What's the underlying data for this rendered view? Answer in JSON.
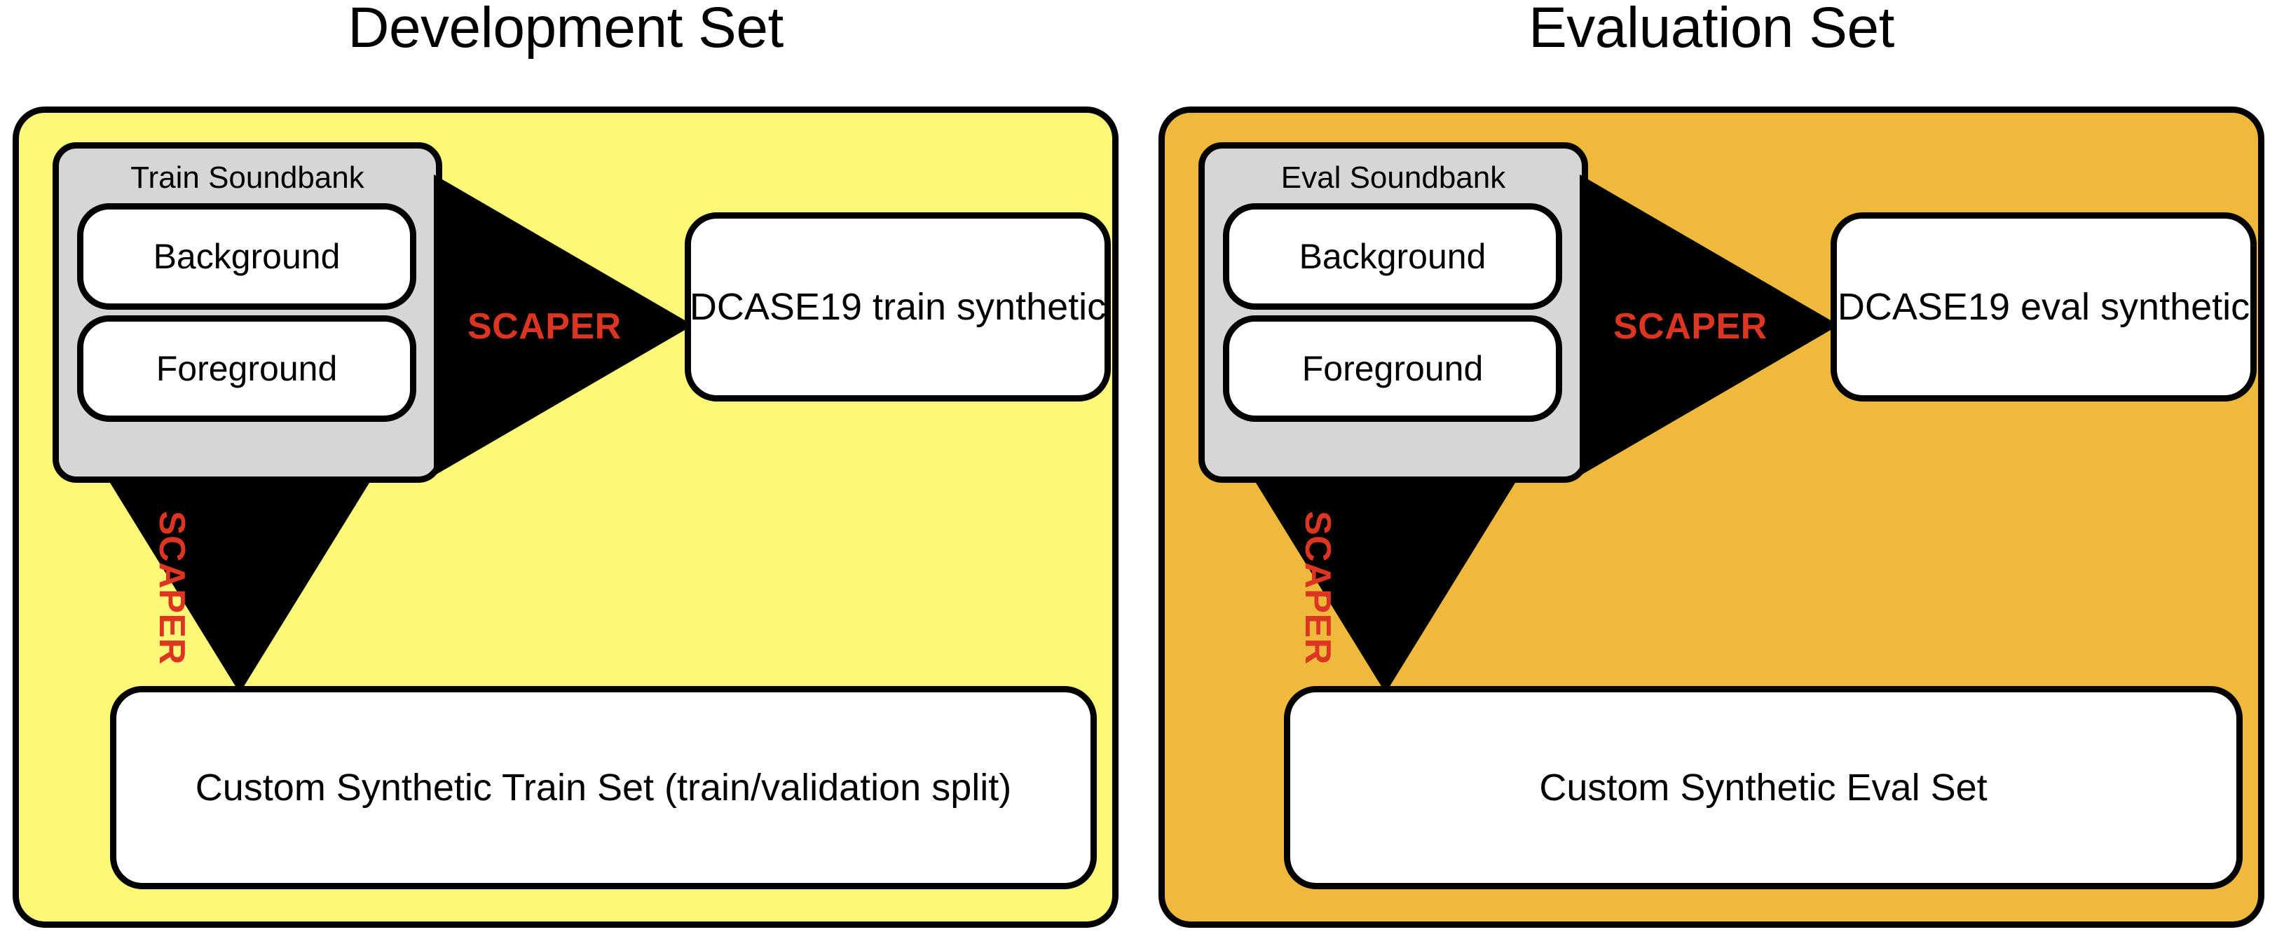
{
  "diagram": {
    "accent_red": "#DC3522",
    "outline_color": "#000000",
    "soundbank_color": "#D6D6D6",
    "box_color": "#FFFFFF"
  },
  "panels": [
    {
      "id": "development",
      "title": "Development Set",
      "background_color": "#FDF877",
      "soundbank": {
        "title": "Train Soundbank",
        "items": [
          {
            "label": "Background"
          },
          {
            "label": "Foreground"
          }
        ]
      },
      "arrow_right": {
        "label": "SCAPER",
        "icon": "arrow-right-triangle",
        "target": "DCASE19 train synthetic"
      },
      "arrow_down": {
        "label": "SCAPER",
        "icon": "arrow-down-triangle",
        "target": "Custom Synthetic Train Set (train/validation split)"
      }
    },
    {
      "id": "evaluation",
      "title": "Evaluation Set",
      "background_color": "#EFB93C",
      "soundbank": {
        "title": "Eval Soundbank",
        "items": [
          {
            "label": "Background"
          },
          {
            "label": "Foreground"
          }
        ]
      },
      "arrow_right": {
        "label": "SCAPER",
        "icon": "arrow-right-triangle",
        "target": "DCASE19 eval synthetic"
      },
      "arrow_down": {
        "label": "SCAPER",
        "icon": "arrow-down-triangle",
        "target": "Custom Synthetic Eval Set"
      }
    }
  ]
}
